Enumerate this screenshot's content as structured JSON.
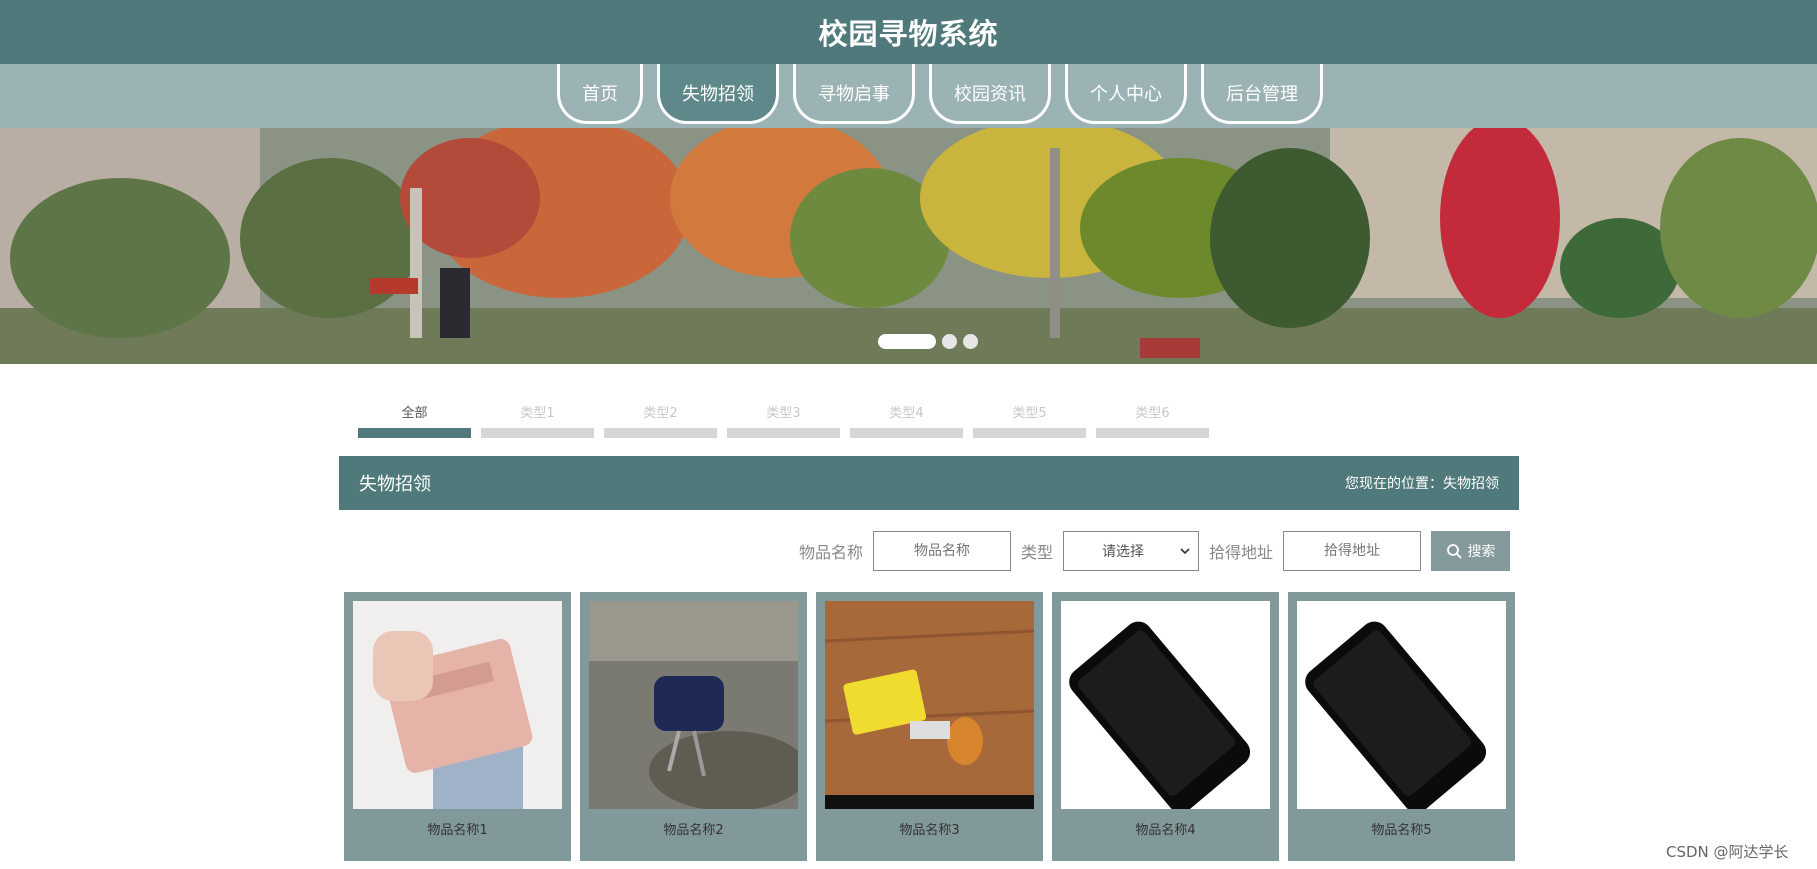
{
  "header": {
    "title": "校园寻物系统"
  },
  "nav": {
    "items": [
      {
        "label": "首页",
        "active": false
      },
      {
        "label": "失物招领",
        "active": true
      },
      {
        "label": "寻物启事",
        "active": false
      },
      {
        "label": "校园资讯",
        "active": false
      },
      {
        "label": "个人中心",
        "active": false
      },
      {
        "label": "后台管理",
        "active": false
      }
    ]
  },
  "categories": {
    "items": [
      {
        "label": "全部",
        "active": true
      },
      {
        "label": "类型1",
        "active": false
      },
      {
        "label": "类型2",
        "active": false
      },
      {
        "label": "类型3",
        "active": false
      },
      {
        "label": "类型4",
        "active": false
      },
      {
        "label": "类型5",
        "active": false
      },
      {
        "label": "类型6",
        "active": false
      }
    ]
  },
  "section": {
    "title": "失物招领",
    "breadcrumb": "您现在的位置：失物招领"
  },
  "search": {
    "name_label": "物品名称",
    "name_placeholder": "物品名称",
    "type_label": "类型",
    "type_value": "请选择",
    "address_label": "拾得地址",
    "address_placeholder": "拾得地址",
    "button_label": "搜索"
  },
  "cards": [
    {
      "name": "物品名称1",
      "image": "wallet"
    },
    {
      "name": "物品名称2",
      "image": "keys-pouch"
    },
    {
      "name": "物品名称3",
      "image": "keys-card"
    },
    {
      "name": "物品名称4",
      "image": "phone"
    },
    {
      "name": "物品名称5",
      "image": "phone"
    }
  ],
  "watermark": "CSDN @阿达学长",
  "colors": {
    "primary": "#50797b",
    "nav": "#9cb3b5",
    "card": "#82999b"
  }
}
